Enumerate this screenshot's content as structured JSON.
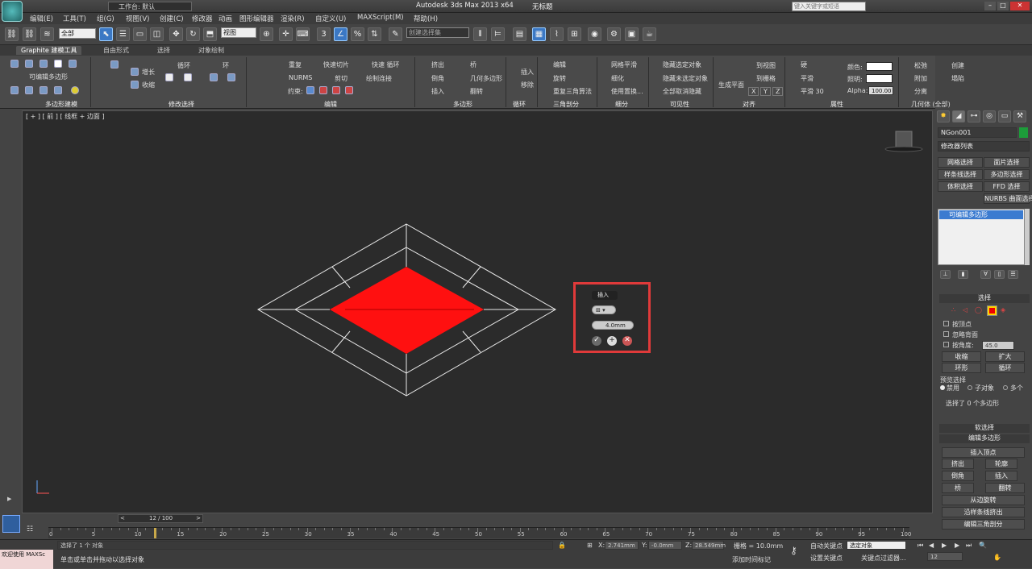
{
  "title": {
    "app": "Autodesk 3ds Max  2013 x64",
    "file": "无标题",
    "workspace": "工作台: 默认",
    "search_placeholder": "键入关键字或短语"
  },
  "menus": [
    "编辑(E)",
    "工具(T)",
    "组(G)",
    "视图(V)",
    "创建(C)",
    "修改器",
    "动画",
    "图形编辑器",
    "渲染(R)",
    "自定义(U)",
    "MAXScript(M)",
    "帮助(H)"
  ],
  "toolbar": {
    "filter": "全部",
    "coord": "视图",
    "selset": "创建选择集"
  },
  "ribbon": {
    "tabs": [
      "Graphite 建模工具",
      "自由形式",
      "选择",
      "对象绘制"
    ],
    "poly_modeling": {
      "sub": "可编辑多边形",
      "title": "多边形建模"
    },
    "modify_sel": {
      "grow": "增长",
      "shrink": "收缩",
      "loop": "循环",
      "ring": "环",
      "title": "修改选择"
    },
    "edit": {
      "repeat": "重复",
      "quickslice": "快速切片",
      "quickloop": "快速 循环",
      "nurms": "NURMS",
      "cut": "剪切",
      "paintconnect": "绘制连接",
      "constraint": "约束:",
      "title": "编辑"
    },
    "polygons": {
      "extrude": "挤出",
      "bridge": "桥",
      "bevel": "倒角",
      "geopoly": "几何多边形",
      "inset": "插入",
      "flip": "翻转",
      "title": "多边形"
    },
    "loops": {
      "insert": "插入",
      "remove": "移除",
      "title": "循环"
    },
    "tris": {
      "edit": "编辑",
      "turn": "旋转",
      "retri": "重复三角算法",
      "title": "三角剖分"
    },
    "subdiv": {
      "meshsmooth": "网格平滑",
      "tessellate": "细化",
      "displace": "使用置换...",
      "title": "细分"
    },
    "vis": {
      "hidesel": "隐藏选定对象",
      "hideunsel": "隐藏未选定对象",
      "unhide": "全部取消隐藏",
      "title": "可见性"
    },
    "align": {
      "make_planar": "生成平面",
      "toview": "到视图",
      "togrid": "到栅格",
      "x": "X",
      "y": "Y",
      "z": "Z",
      "title": "对齐"
    },
    "props": {
      "hard": "硬",
      "smooth": "平滑",
      "smooth30": "平滑 30",
      "color": "颜色:",
      "illum": "照明:",
      "alpha": "Alpha:",
      "alpha_val": "100.00",
      "title": "属性"
    },
    "geom": {
      "relax": "松弛",
      "attach": "附加",
      "detach": "分离",
      "create": "创建",
      "collapse": "塌陷",
      "title": "几何体 (全部)"
    }
  },
  "viewport": {
    "label": "[ + ] [ 前 ] [ 线框 + 边面 ]",
    "bg": "#2b2b2b",
    "fill": "#ff1010"
  },
  "popup": {
    "title": "插入",
    "amount": "4.0mm"
  },
  "cmdpanel": {
    "name": "NGon001",
    "modlist": "修改器列表",
    "btns": [
      "网格选择",
      "面片选择",
      "样条线选择",
      "多边形选择",
      "体积选择",
      "FFD 选择",
      "NURBS 曲面选择"
    ],
    "stack_item": "可编辑多边形",
    "sel_title": "选择",
    "by_vertex": "按顶点",
    "ignore_back": "忽略背面",
    "by_angle": "按角度:",
    "angle_val": "45.0",
    "shrink": "收缩",
    "grow": "扩大",
    "ring": "环形",
    "loop": "循环",
    "preview": "预览选择",
    "disabled": "禁用",
    "subobj": "子对象",
    "multi": "多个",
    "status": "选择了 0 个多边形",
    "soft": "软选择",
    "editpoly": "编辑多边形",
    "insert_vertex": "插入顶点",
    "extrude": "挤出",
    "outline": "轮廓",
    "bevel": "倒角",
    "inset": "插入",
    "bridge": "桥",
    "flip": "翻转",
    "hinge": "从边旋转",
    "extrude_spline": "沿样条线挤出",
    "edit_tri": "编辑三角剖分"
  },
  "timeline": {
    "frame": "12 / 100",
    "ticks": [
      "0",
      "5",
      "10",
      "15",
      "20",
      "25",
      "30",
      "35",
      "40",
      "45",
      "50",
      "55",
      "60",
      "65",
      "70",
      "75",
      "80",
      "85",
      "90",
      "95",
      "100"
    ],
    "current": 12
  },
  "status": {
    "welcome": "欢迎使用 MAXSc",
    "line1": "选择了 1 个 对象",
    "line2": "单击或单击并拖动以选择对象",
    "x": "2.741mm",
    "y": "-0.0mm",
    "z": "28.549mm",
    "grid": "栅格 = 10.0mm",
    "addtime": "添加时间标记",
    "autokey": "自动关键点",
    "setkey": "设置关键点",
    "selobj": "选定对象",
    "keyfilter": "关键点过滤器...",
    "frame": "12"
  }
}
